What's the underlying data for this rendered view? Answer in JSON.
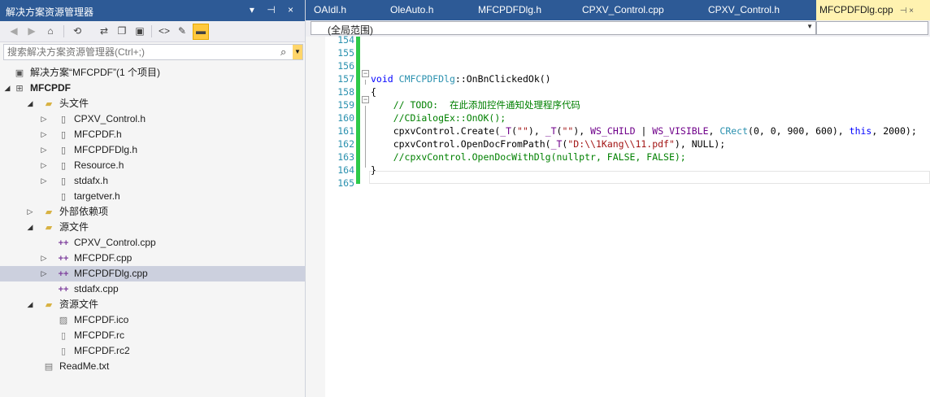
{
  "solution_explorer": {
    "title": "解决方案资源管理器",
    "title_controls": "▾ ⊣ ×",
    "toolbar": {
      "back": "◀",
      "forward": "▶",
      "home": "⌂",
      "history": "⟲",
      "sync": "⇄",
      "collapse": "❐",
      "show_all": "▣",
      "code": "<>",
      "properties": "✎",
      "preview": "▬"
    },
    "search": {
      "placeholder": "搜索解决方案资源管理器(Ctrl+;)",
      "value": ""
    },
    "tree": [
      {
        "label": "解决方案“MFCPDF”(1 个项目)",
        "icon": "solution-icon",
        "glyph": "▣",
        "expander": "",
        "level": 0
      },
      {
        "label": "MFCPDF",
        "icon": "project-icon",
        "glyph": "⊞",
        "expander": "◢",
        "level": 0,
        "bold": true
      },
      {
        "label": "头文件",
        "icon": "folder-icon",
        "glyph": "▰",
        "expander": "◢",
        "level": 1
      },
      {
        "label": "CPXV_Control.h",
        "icon": "header-file-icon",
        "glyph": "▯",
        "expander": "▷",
        "level": 2
      },
      {
        "label": "MFCPDF.h",
        "icon": "header-file-icon",
        "glyph": "▯",
        "expander": "▷",
        "level": 2
      },
      {
        "label": "MFCPDFDlg.h",
        "icon": "header-file-icon",
        "glyph": "▯",
        "expander": "▷",
        "level": 2
      },
      {
        "label": "Resource.h",
        "icon": "header-file-icon",
        "glyph": "▯",
        "expander": "▷",
        "level": 2
      },
      {
        "label": "stdafx.h",
        "icon": "header-file-icon",
        "glyph": "▯",
        "expander": "▷",
        "level": 2
      },
      {
        "label": "targetver.h",
        "icon": "header-file-icon",
        "glyph": "▯",
        "expander": "",
        "level": 2
      },
      {
        "label": "外部依赖项",
        "icon": "folder-icon",
        "glyph": "▰",
        "expander": "▷",
        "level": 1
      },
      {
        "label": "源文件",
        "icon": "folder-icon",
        "glyph": "▰",
        "expander": "◢",
        "level": 1
      },
      {
        "label": "CPXV_Control.cpp",
        "icon": "cpp-file-icon",
        "glyph": "++",
        "expander": "",
        "level": 2
      },
      {
        "label": "MFCPDF.cpp",
        "icon": "cpp-file-icon",
        "glyph": "++",
        "expander": "▷",
        "level": 2
      },
      {
        "label": "MFCPDFDlg.cpp",
        "icon": "cpp-file-icon",
        "glyph": "++",
        "expander": "▷",
        "level": 2,
        "selected": true
      },
      {
        "label": "stdafx.cpp",
        "icon": "cpp-file-icon",
        "glyph": "++",
        "expander": "",
        "level": 2
      },
      {
        "label": "资源文件",
        "icon": "folder-icon",
        "glyph": "▰",
        "expander": "◢",
        "level": 1
      },
      {
        "label": "MFCPDF.ico",
        "icon": "image-file-icon",
        "glyph": "▨",
        "expander": "",
        "level": 2
      },
      {
        "label": "MFCPDF.rc",
        "icon": "resource-file-icon",
        "glyph": "▯",
        "expander": "",
        "level": 2
      },
      {
        "label": "MFCPDF.rc2",
        "icon": "resource-file-icon",
        "glyph": "▯",
        "expander": "",
        "level": 2
      },
      {
        "label": "ReadMe.txt",
        "icon": "text-file-icon",
        "glyph": "▤",
        "expander": "",
        "level": 1
      }
    ]
  },
  "editor": {
    "tabs": [
      {
        "label": "OAIdl.h",
        "active": false
      },
      {
        "label": "OleAuto.h",
        "active": false
      },
      {
        "label": "MFCPDFDlg.h",
        "active": false
      },
      {
        "label": "CPXV_Control.cpp",
        "active": false
      },
      {
        "label": "CPXV_Control.h",
        "active": false
      },
      {
        "label": "MFCPDFDlg.cpp",
        "active": true,
        "pin": "⊣ ×"
      }
    ],
    "scope": "(全局范围)",
    "lines": [
      {
        "num": "154",
        "html": ""
      },
      {
        "num": "155",
        "html": ""
      },
      {
        "num": "156",
        "html": ""
      },
      {
        "num": "157",
        "html": "<span class=\"kw\">void</span> <span class=\"ty\">CMFCPDFDlg</span>::OnBnClickedOk()"
      },
      {
        "num": "158",
        "html": "{"
      },
      {
        "num": "159",
        "html": "    <span class=\"cm\">// TODO:  在此添加控件通知处理程序代码</span>"
      },
      {
        "num": "160",
        "html": "    <span class=\"cm\">//CDialogEx::OnOK();</span>"
      },
      {
        "num": "161",
        "html": "    cpxvControl.Create(<span class=\"mc\">_T</span>(<span class=\"st\">\"\"</span>), <span class=\"mc\">_T</span>(<span class=\"st\">\"\"</span>), <span class=\"mc\">WS_CHILD</span> | <span class=\"mc\">WS_VISIBLE</span>, <span class=\"ty\">CRect</span>(0, 0, 900, 600), <span class=\"kw\">this</span>, 2000);"
      },
      {
        "num": "162",
        "html": "    cpxvControl.OpenDocFromPath(<span class=\"mc\">_T</span>(<span class=\"st\">\"D:\\\\1Kang\\\\11.pdf\"</span>), NULL);"
      },
      {
        "num": "163",
        "html": "    <span class=\"cm\">//cpxvControl.OpenDocWithDlg(nullptr, FALSE, FALSE);</span>"
      },
      {
        "num": "164",
        "html": "}"
      },
      {
        "num": "165",
        "html": ""
      }
    ]
  }
}
